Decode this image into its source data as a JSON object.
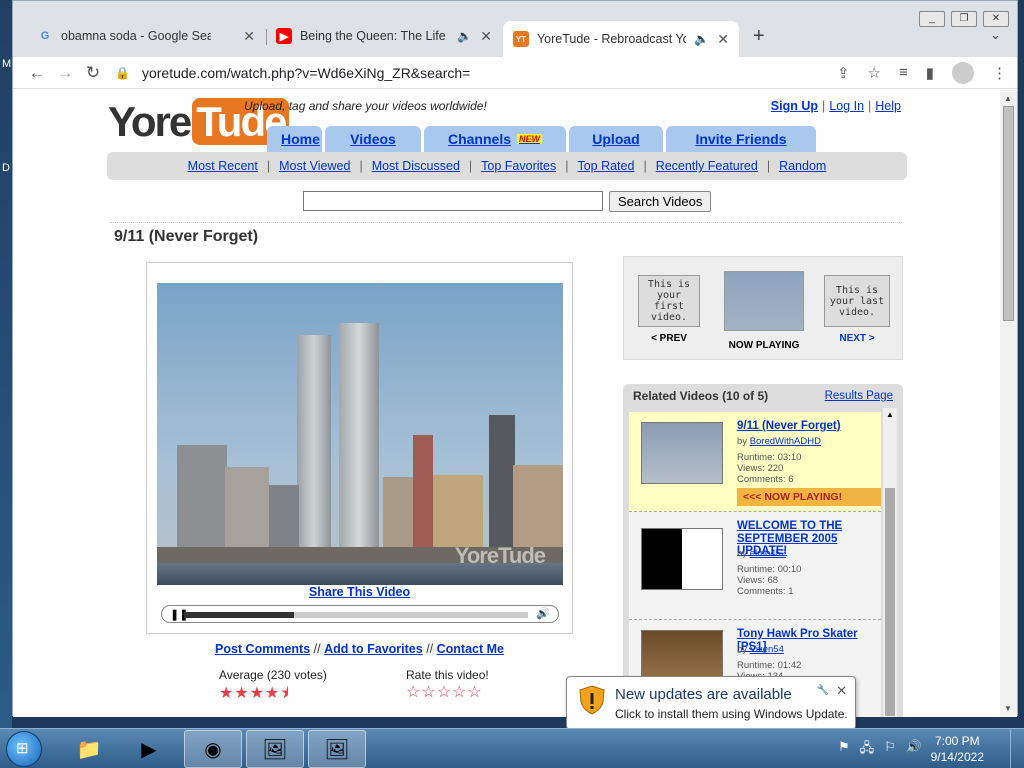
{
  "desktop": {
    "letters": [
      "M",
      "D"
    ]
  },
  "browser": {
    "tabs": [
      {
        "title": "obamna soda - Google Search",
        "favicon": "G"
      },
      {
        "title": "Being the Queen: The Life of",
        "favicon": "youtube-icon"
      },
      {
        "title": "YoreTude - Rebroadcast Your",
        "favicon": "yoretude-icon"
      }
    ],
    "url": "yoretude.com/watch.php?v=Wd6eXiNg_ZR&search="
  },
  "site": {
    "logo_left": "Yore",
    "logo_right": "Tude",
    "tagline": "Upload, tag and share your videos worldwide!",
    "sign_up": "Sign Up",
    "log_in": "Log In",
    "help": "Help",
    "nav": {
      "home": "Home",
      "videos": "Videos",
      "channels": "Channels",
      "new": "NEW",
      "upload": "Upload",
      "invite": "Invite Friends"
    },
    "subnav": [
      "Most Recent",
      "Most Viewed",
      "Most Discussed",
      "Top Favorites",
      "Top Rated",
      "Recently Featured",
      "Random"
    ],
    "search_button": "Search Videos"
  },
  "video": {
    "title": "9/11 (Never Forget)",
    "watermark": "YoreTude",
    "share": "Share This Video",
    "progress": 0.32,
    "post_comments": "Post Comments",
    "sep": "//",
    "add_fav": "Add to Favorites",
    "contact": "Contact Me",
    "average": "Average (230 votes)",
    "average_stars": "★★★★⯨",
    "rate_label": "Rate this video!",
    "rate_stars": "☆☆☆☆☆"
  },
  "now_nav": {
    "prev_thumb": "This is your first video.",
    "prev": "< PREV",
    "now": "NOW PLAYING",
    "next_thumb": "This is your last video.",
    "next": "NEXT >"
  },
  "related": {
    "header": "Related Videos (10 of 5)",
    "results": "Results Page",
    "items": [
      {
        "title": "9/11 (Never Forget)",
        "by": "by",
        "user": "BoredWithADHD",
        "runtime": "Runtime: 03:10",
        "views": "Views: 220",
        "comments": "Comments: 6",
        "now": "<<< NOW PLAYING!"
      },
      {
        "title": "WELCOME TO THE SEPTEMBER 2005 UPDATE!",
        "by": "by",
        "user": "elmo452",
        "runtime": "Runtime: 00:10",
        "views": "Views: 68",
        "comments": "Comments: 1"
      },
      {
        "title": "Tony Hawk Pro Skater [PS1]",
        "by": "by",
        "user": "Vixen54",
        "runtime": "Runtime: 01:42",
        "views": "Views: 134"
      }
    ]
  },
  "notification": {
    "title": "New updates are available",
    "subtitle": "Click to install them using Windows Update."
  },
  "taskbar": {
    "time": "7:00 PM",
    "date": "9/14/2022"
  }
}
